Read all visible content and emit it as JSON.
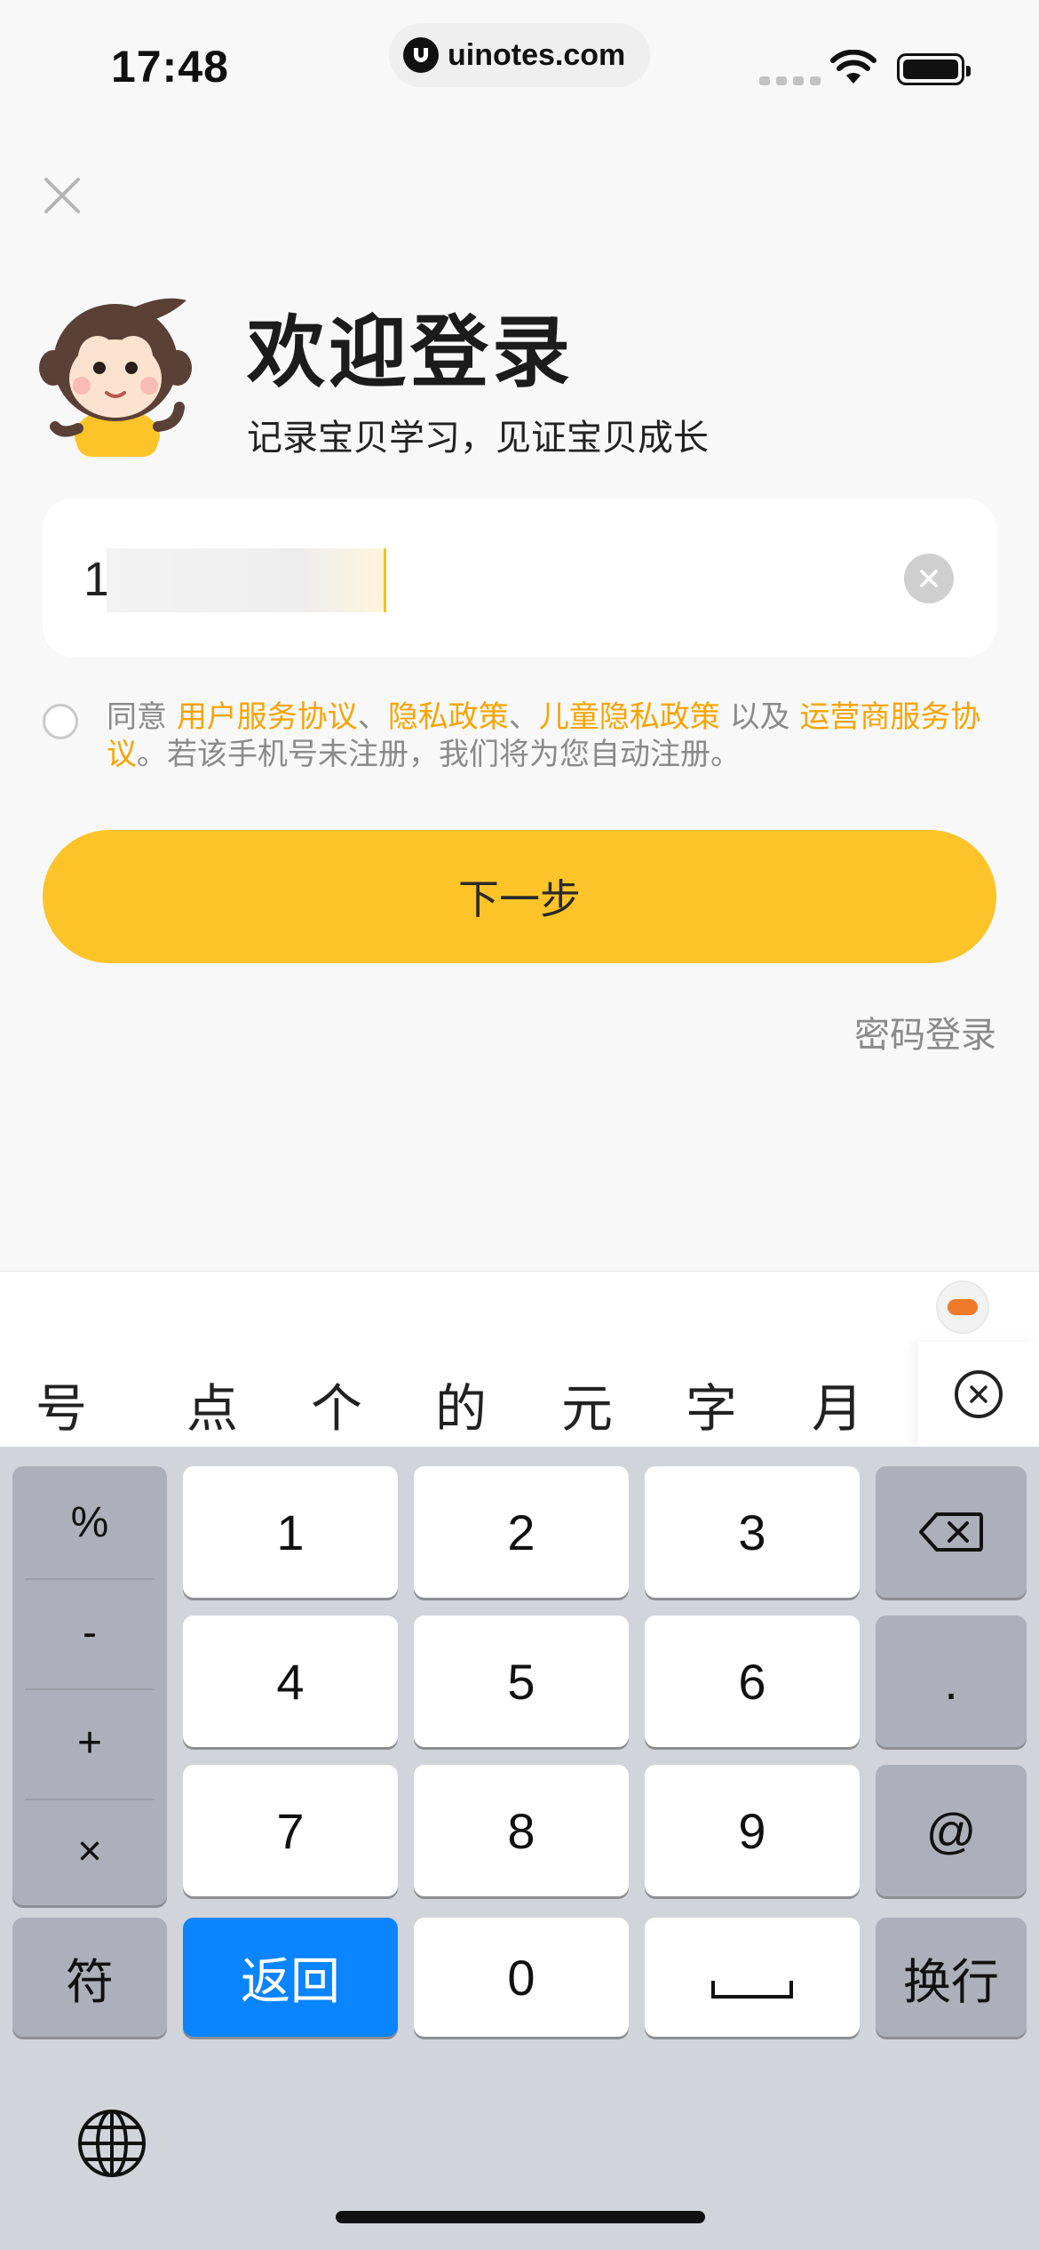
{
  "status_bar": {
    "time": "17:48",
    "url": "uinotes.com"
  },
  "login": {
    "title": "欢迎登录",
    "subtitle": "记录宝贝学习，见证宝贝成长",
    "phone_value": "1",
    "agreement": {
      "prefix": "同意 ",
      "user_agreement": "用户服务协议",
      "sep1": "、",
      "privacy_policy": "隐私政策",
      "sep2": "、",
      "children_privacy": "儿童隐私政策",
      "and": " 以及 ",
      "carrier_agreement": "运营商服务协议",
      "suffix": "。若该手机号未注册，我们将为您自动注册。"
    },
    "next_button": "下一步",
    "password_login": "密码登录"
  },
  "keyboard": {
    "candidates": [
      "号",
      "点",
      "个",
      "的",
      "元",
      "字",
      "月"
    ],
    "symbols": [
      "%",
      "-",
      "+",
      "×"
    ],
    "digits": [
      "1",
      "2",
      "3",
      "4",
      "5",
      "6",
      "7",
      "8",
      "9",
      "0"
    ],
    "dot_key": ".",
    "at_key": "@",
    "symbol_key": "符",
    "return_key": "返回",
    "newline_key": "换行"
  },
  "colors": {
    "accent": "#fdc42a",
    "link": "#f7a400",
    "return_key": "#0a84ff"
  }
}
